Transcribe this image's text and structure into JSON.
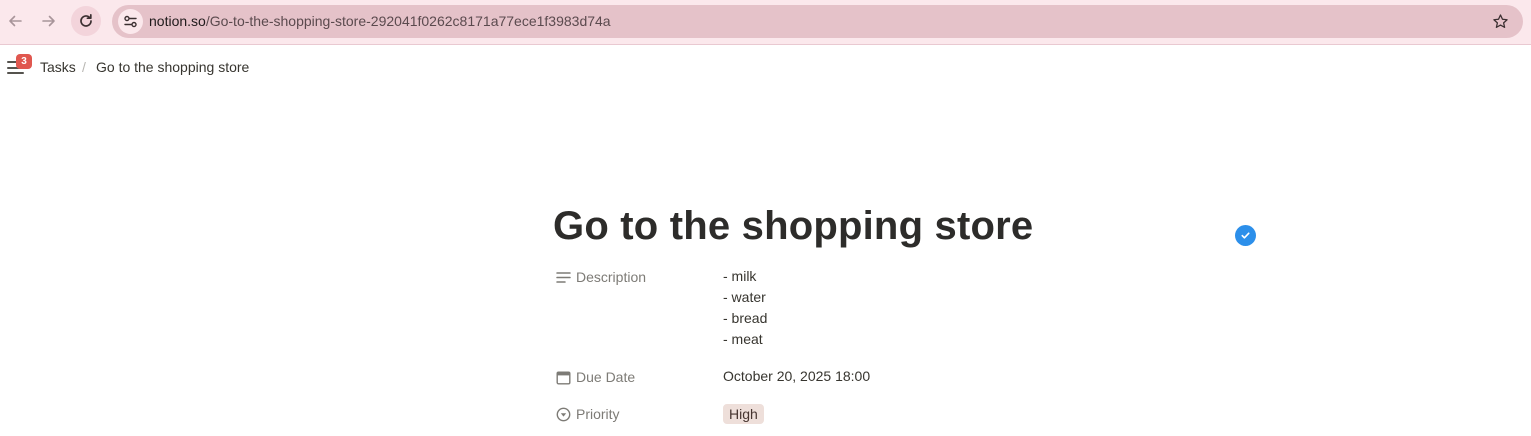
{
  "browser": {
    "url_domain": "notion.so",
    "url_path": "/Go-to-the-shopping-store-292041f0262c8171a77ece1f3983d74a",
    "back_icon": "arrow-left-icon",
    "forward_icon": "arrow-right-icon",
    "reload_icon": "reload-icon",
    "site_info_icon": "tune-icon",
    "bookmark_icon": "star-icon"
  },
  "topbar": {
    "menu_icon": "hamburger-icon",
    "notification_count": "3",
    "breadcrumb": [
      {
        "label": "Tasks"
      },
      {
        "label": "/"
      },
      {
        "label": "Go to the shopping store"
      }
    ]
  },
  "page": {
    "title": "Go to the shopping store",
    "status_icon": "check-circle-icon",
    "status_color": "#2c8fea",
    "properties": {
      "description": {
        "label": "Description",
        "icon": "text-lines-icon",
        "lines": [
          "- milk",
          "- water",
          "- bread",
          "- meat"
        ]
      },
      "due_date": {
        "label": "Due Date",
        "icon": "calendar-icon",
        "value": "October 20, 2025 18:00"
      },
      "priority": {
        "label": "Priority",
        "icon": "select-circle-icon",
        "value": "High",
        "tag_color": "#eedfda"
      }
    }
  }
}
